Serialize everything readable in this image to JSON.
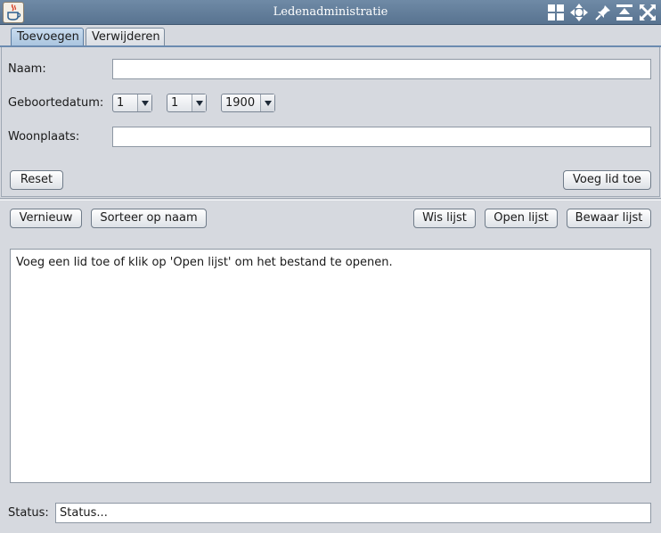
{
  "window": {
    "title": "Ledenadministratie"
  },
  "tabs": [
    {
      "label": "Toevoegen",
      "active": true
    },
    {
      "label": "Verwijderen",
      "active": false
    }
  ],
  "form": {
    "name_label": "Naam:",
    "name_value": "",
    "birthdate_label": "Geboortedatum:",
    "day": "1",
    "month": "1",
    "year": "1900",
    "city_label": "Woonplaats:",
    "city_value": "",
    "reset_label": "Reset",
    "add_member_label": "Voeg lid toe"
  },
  "toolbar": {
    "new_label": "Vernieuw",
    "sort_label": "Sorteer op naam",
    "clear_label": "Wis lijst",
    "open_label": "Open lijst",
    "save_label": "Bewaar lijst"
  },
  "output": {
    "text": "Voeg een lid toe of klik op 'Open lijst' om het bestand te openen."
  },
  "status": {
    "label": "Status:",
    "value": "Status..."
  },
  "colors": {
    "titlebar": "#587390",
    "background": "#d6d9df",
    "active_tab": "#a9c4de"
  },
  "icons": {
    "app": "java-cup-icon",
    "window_controls": [
      "tile-icon",
      "move-icon",
      "pin-icon",
      "minimize-icon",
      "close-icon"
    ]
  }
}
